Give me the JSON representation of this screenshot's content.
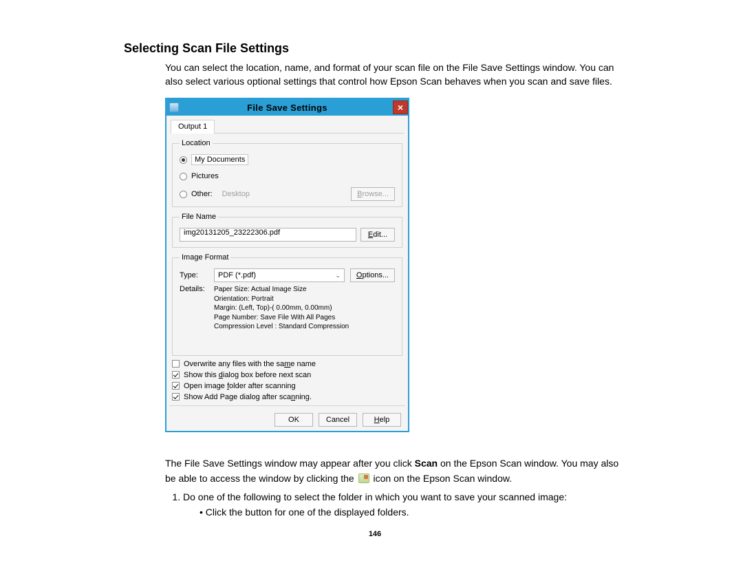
{
  "doc": {
    "heading": "Selecting Scan File Settings",
    "intro": "You can select the location, name, and format of your scan file on the File Save Settings window. You can also select various optional settings that control how Epson Scan behaves when you scan and save files.",
    "para2_a": "The File Save Settings window may appear after you click ",
    "para2_bold": "Scan",
    "para2_b": " on the Epson Scan window. You may also be able to access the window by clicking the ",
    "para2_c": " icon on the Epson Scan window.",
    "step1": "Do one of the following to select the folder in which you want to save your scanned image:",
    "bullet1": "Click the button for one of the displayed folders.",
    "page_num": "146"
  },
  "dlg": {
    "title": "File Save Settings",
    "tab": "Output 1",
    "location": {
      "legend": "Location",
      "mydocs": "My Documents",
      "pictures": "Pictures",
      "other": "Other:",
      "other_path": "Desktop",
      "browse": "Browse..."
    },
    "filename": {
      "legend": "File Name",
      "value": "img20131205_23222306.pdf",
      "edit": "Edit..."
    },
    "format": {
      "legend": "Image Format",
      "type_label": "Type:",
      "type_value": "PDF (*.pdf)",
      "options": "Options...",
      "details_label": "Details:",
      "d1": "Paper Size: Actual Image Size",
      "d2": "Orientation: Portrait",
      "d3": "Margin: (Left, Top)-( 0.00mm, 0.00mm)",
      "d4": "Page Number: Save File With All Pages",
      "d5": "Compression Level : Standard Compression"
    },
    "checks": {
      "c1": "Overwrite any files with the same name",
      "c2": "Show this dialog box before next scan",
      "c3": "Open image folder after scanning",
      "c4": "Show Add Page dialog after scanning."
    },
    "buttons": {
      "ok": "OK",
      "cancel": "Cancel",
      "help": "Help"
    }
  }
}
